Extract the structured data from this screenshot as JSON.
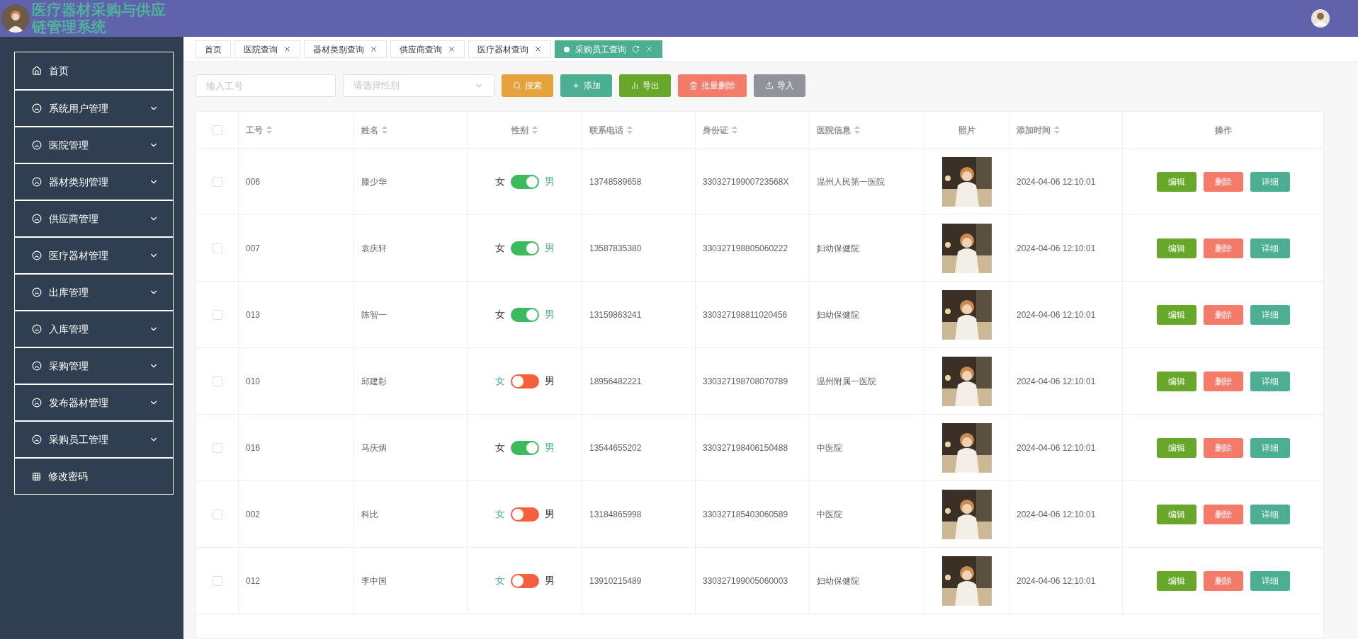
{
  "header": {
    "title": "医疗器材采购与供应链管理系统"
  },
  "sidebar": {
    "items": [
      {
        "label": "首页",
        "kind": "home"
      },
      {
        "label": "系统用户管理",
        "kind": "group"
      },
      {
        "label": "医院管理",
        "kind": "group"
      },
      {
        "label": "器材类别管理",
        "kind": "group"
      },
      {
        "label": "供应商管理",
        "kind": "group"
      },
      {
        "label": "医疗器材管理",
        "kind": "group"
      },
      {
        "label": "出库管理",
        "kind": "group"
      },
      {
        "label": "入库管理",
        "kind": "group"
      },
      {
        "label": "采购管理",
        "kind": "group"
      },
      {
        "label": "发布器材管理",
        "kind": "group"
      },
      {
        "label": "采购员工管理",
        "kind": "group"
      },
      {
        "label": "修改密码",
        "kind": "grid"
      }
    ]
  },
  "tabs": [
    {
      "label": "首页",
      "selected": false,
      "closable": false
    },
    {
      "label": "医院查询",
      "selected": false,
      "closable": true
    },
    {
      "label": "器材类别查询",
      "selected": false,
      "closable": true
    },
    {
      "label": "供应商查询",
      "selected": false,
      "closable": true
    },
    {
      "label": "医疗器材查询",
      "selected": false,
      "closable": true
    },
    {
      "label": "采购员工查询",
      "selected": true,
      "closable": true
    }
  ],
  "toolbar": {
    "id_placeholder": "输入工号",
    "gender_placeholder": "请选择性别",
    "buttons": [
      {
        "label": "搜索",
        "kind": "search"
      },
      {
        "label": "添加",
        "kind": "add"
      },
      {
        "label": "导出",
        "kind": "export"
      },
      {
        "label": "批量删除",
        "kind": "delete"
      },
      {
        "label": "导入",
        "kind": "import"
      }
    ]
  },
  "table": {
    "select_all_checked": false,
    "columns": [
      {
        "kind": "check"
      },
      {
        "label": "工号",
        "kind": "text",
        "sortable": true
      },
      {
        "label": "姓名",
        "kind": "text",
        "sortable": true
      },
      {
        "label": "性别",
        "kind": "gender",
        "sortable": true
      },
      {
        "label": "联系电话",
        "kind": "text",
        "sortable": true
      },
      {
        "label": "身份证",
        "kind": "text",
        "sortable": true
      },
      {
        "label": "医院信息",
        "kind": "text",
        "sortable": true
      },
      {
        "label": "照片",
        "sortable": false
      },
      {
        "label": "添加时间",
        "kind": "text",
        "sortable": true
      },
      {
        "label": "操作",
        "kind": "actions",
        "sortable": false
      }
    ],
    "rows": [
      {
        "checked": false,
        "id": "006",
        "name": "滕少华",
        "female_label": "女",
        "male_label": "男",
        "male": true,
        "phone": "13748589658",
        "id_card": "33032719900723568X",
        "hospital": "温州人民第一医院",
        "added": "2024-04-06 12:10:01",
        "actions": [
          "编辑",
          "删除",
          "详细"
        ]
      },
      {
        "checked": false,
        "id": "007",
        "name": "袁庆轩",
        "female_label": "女",
        "male_label": "男",
        "male": true,
        "phone": "13587835380",
        "id_card": "330327198805060222",
        "hospital": "妇幼保健院",
        "added": "2024-04-06 12:10:01",
        "actions": [
          "编辑",
          "删除",
          "详细"
        ]
      },
      {
        "checked": false,
        "id": "013",
        "name": "陈智一",
        "female_label": "女",
        "male_label": "男",
        "male": true,
        "phone": "13159863241",
        "id_card": "330327198811020456",
        "hospital": "妇幼保健院",
        "added": "2024-04-06 12:10:01",
        "actions": [
          "编辑",
          "删除",
          "详细"
        ]
      },
      {
        "checked": false,
        "id": "010",
        "name": "邱建彰",
        "female_label": "女",
        "male_label": "男",
        "male": false,
        "phone": "18956482221",
        "id_card": "330327198708070789",
        "hospital": "温州附属一医院",
        "added": "2024-04-06 12:10:01",
        "actions": [
          "编辑",
          "删除",
          "详细"
        ]
      },
      {
        "checked": false,
        "id": "016",
        "name": "马庆炳",
        "female_label": "女",
        "male_label": "男",
        "male": true,
        "phone": "13544655202",
        "id_card": "330327198406150488",
        "hospital": "中医院",
        "added": "2024-04-06 12:10:01",
        "actions": [
          "编辑",
          "删除",
          "详细"
        ]
      },
      {
        "checked": false,
        "id": "002",
        "name": "科比",
        "female_label": "女",
        "male_label": "男",
        "male": false,
        "phone": "13184865998",
        "id_card": "330327185403060589",
        "hospital": "中医院",
        "added": "2024-04-06 12:10:01",
        "actions": [
          "编辑",
          "删除",
          "详细"
        ]
      },
      {
        "checked": false,
        "id": "012",
        "name": "李中国",
        "female_label": "女",
        "male_label": "男",
        "male": false,
        "phone": "13910215489",
        "id_card": "330327199005060003",
        "hospital": "妇幼保健院",
        "added": "2024-04-06 12:10:01",
        "actions": [
          "编辑",
          "删除",
          "详细"
        ]
      }
    ]
  }
}
